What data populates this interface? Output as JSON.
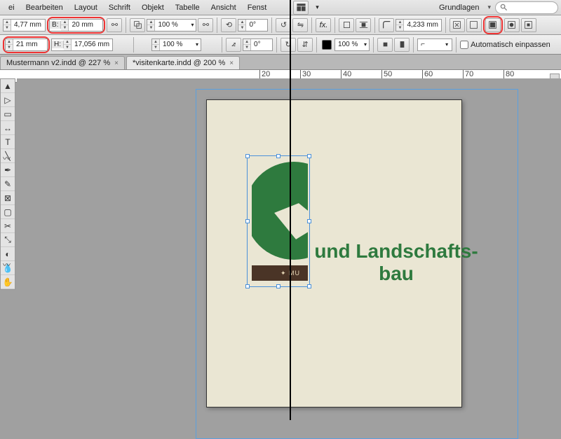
{
  "menu": {
    "items": [
      "ei",
      "Bearbeiten",
      "Layout",
      "Schrift",
      "Objekt",
      "Tabelle",
      "Ansicht",
      "Fenst"
    ],
    "workspace": "Grundlagen"
  },
  "controlbar": {
    "x": {
      "label": "",
      "value": "4,77 mm"
    },
    "y": {
      "label": "",
      "value": "21 mm"
    },
    "w": {
      "label": "B:",
      "value": "20 mm"
    },
    "h": {
      "label": "H:",
      "value": "17,056 mm"
    },
    "scaleX": "100 %",
    "scaleY": "100 %",
    "rotate": "0°",
    "shear": "0°",
    "stroke": "4,233 mm",
    "autofit": "Automatisch einpassen",
    "opacity": "100 %"
  },
  "tabs": [
    {
      "label": "Mustermann v2.indd @ 227 %",
      "active": false
    },
    {
      "label": "*visitenkarte.indd @ 200 %",
      "active": true
    }
  ],
  "ruler": [
    "20",
    "30",
    "40",
    "50",
    "60",
    "70",
    "80"
  ],
  "document": {
    "headline": "und Landschafts-\nbau",
    "ribbon": "✦ MU"
  },
  "icons": {
    "search": "search-icon"
  }
}
